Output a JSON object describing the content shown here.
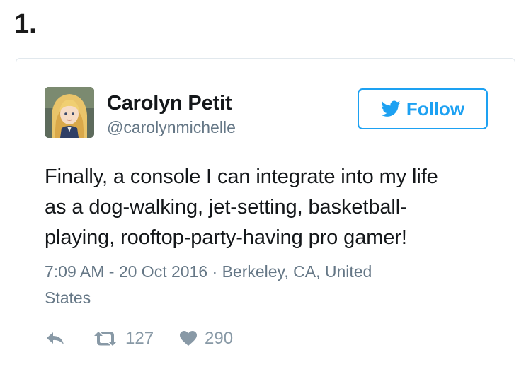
{
  "list_number": "1.",
  "tweet": {
    "author": {
      "display_name": "Carolyn Petit",
      "screen_name": "@carolynmichelle"
    },
    "follow_label": "Follow",
    "text_lines": [
      "Finally, a console I can integrate into my life",
      "as a dog-walking, jet-setting, basketball-",
      "playing, rooftop-party-having pro gamer!"
    ],
    "meta_lines": [
      "7:09 AM - 20 Oct 2016 · Berkeley, CA, United",
      "States"
    ],
    "actions": {
      "reply_icon": "reply-icon",
      "retweet_icon": "retweet-icon",
      "retweet_count": "127",
      "like_icon": "heart-icon",
      "like_count": "290"
    }
  },
  "colors": {
    "brand": "#1da1f2",
    "muted_text": "#657786",
    "action_gray": "#8899a6",
    "card_border": "#e1e8ed"
  }
}
